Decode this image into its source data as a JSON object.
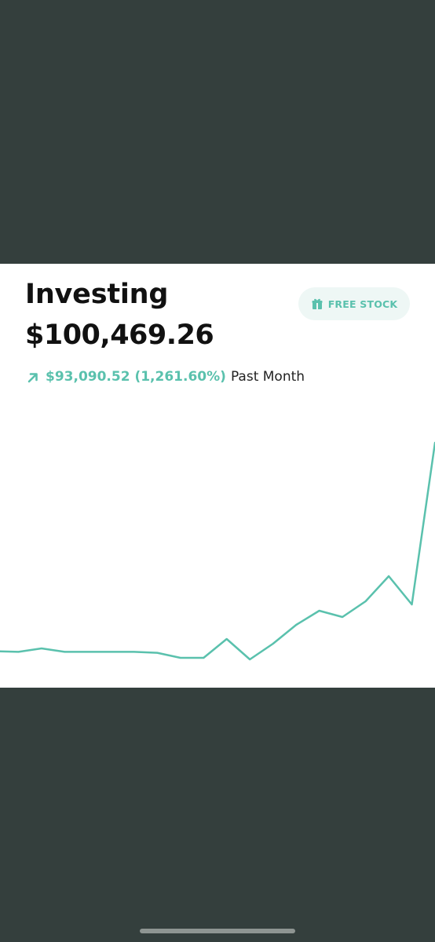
{
  "header": {
    "title": "Investing",
    "portfolio_value": "$100,469.26",
    "change_amount": "$93,090.52 (1,261.60%)",
    "change_period": "Past Month",
    "change_direction_icon": "arrow-up-right-icon"
  },
  "free_stock_button": {
    "label": "FREE STOCK",
    "icon": "gift-icon"
  },
  "colors": {
    "accent": "#5ac1ad",
    "dark_background": "#343f3d",
    "card_background": "#ffffff",
    "text_primary": "#111111",
    "button_background": "#eef7f5"
  },
  "chart_data": {
    "type": "line",
    "title": "",
    "xlabel": "",
    "ylabel": "",
    "grid": false,
    "series": [
      {
        "values": [
          3.2,
          2.8,
          5.0,
          2.8,
          2.8,
          2.8,
          2.8,
          2.2,
          -1.0,
          -1.0,
          11.0,
          -2.0,
          8.0,
          20.0,
          29.0,
          25.0,
          35.0,
          51.0,
          33.0,
          136.0
        ]
      }
    ]
  }
}
